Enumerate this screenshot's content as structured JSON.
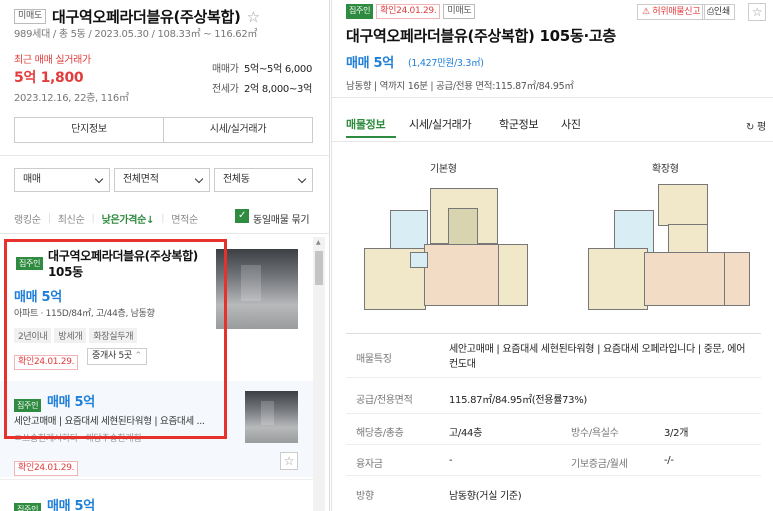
{
  "left": {
    "header": {
      "tag": "미매도",
      "title": "대구역오페라더블유(주상복합)",
      "star": "☆",
      "meta": "989세대 / 총 5동 / 2023.05.30 / 108.33㎡ ~ 116.62㎡"
    },
    "price_summary": {
      "label": "최근 매매 실거래가",
      "price": "5억 1,800",
      "date": "2023.12.16, 22층, 116㎡",
      "sale_label": "매매가",
      "sale_value": "5억~5억 6,000",
      "jeonse_label": "전세가",
      "jeonse_value": "2억 8,000~3억"
    },
    "buttons": {
      "info": "단지정보",
      "price": "시세/실거래가"
    },
    "filters": {
      "trade": "매매",
      "area": "전체면적",
      "dong": "전체동"
    },
    "sort": {
      "ranking": "랭킹순",
      "latest": "최신순",
      "low_price": "낮은가격순↓",
      "area": "면적순",
      "same_label": "동일매물 묶기"
    },
    "listing1": {
      "badge": "집주인",
      "title": "대구역오페라더블유(주상복합) 105동",
      "price": "매매 5억",
      "desc": "아파트 · 115D/84㎡, 고/44층, 남동향",
      "chips": [
        "2년이내",
        "방세개",
        "화장실두개"
      ],
      "confirm": "확인24.01.29.",
      "broker": "중개사 5곳"
    },
    "listing2": {
      "badge": "집주인",
      "price": "매매 5억",
      "desc": "세안고매매 | 요즘대세 세현된타워형 | 요즘대세 ...",
      "sub": "ㄹ쓰승한게시하다 · 해당주승한게힘",
      "confirm": "확인24.01.29.",
      "star": "☆"
    },
    "listing3": {
      "badge": "집주인",
      "price": "매매 5억"
    }
  },
  "right": {
    "tags": [
      "집주인",
      "확인24.01.29.",
      "미매도"
    ],
    "report": "허위매물신고",
    "print": "인쇄",
    "star": "☆",
    "title": "대구역오페라더블유(주상복합) 105동·고층",
    "price": "매매 5억",
    "price_sub": "(1,427만원/3.3㎡)",
    "facts": "남동향 | 역까지 16분 | 공급/전용 면적:115.87㎡/84.95㎡",
    "tabs": [
      "매물정보",
      "시세/실거래가",
      "학군정보",
      "사진"
    ],
    "refresh": "평",
    "floorplans": {
      "basic": "기본형",
      "extended": "확장형"
    },
    "details": [
      {
        "k": "매물특징",
        "v": "세안고매매 | 요즘대세 세현된타워형 | 요즘대세 오페라입니다 | 중문, 에어컨도대"
      },
      {
        "k": "공급/전용면적",
        "v": "115.87㎡/84.95㎡(전용률73%)"
      },
      {
        "k": "해당층/총층",
        "v": "고/44층",
        "k2": "방수/욕실수",
        "v2": "3/2개"
      },
      {
        "k": "융자금",
        "v": "-",
        "k2": "기보증금/월세",
        "v2": "-/-"
      },
      {
        "k": "방향",
        "v": "남동향(거실 기준)"
      }
    ]
  },
  "colors": {
    "accent_blue": "#1e7fd9",
    "green": "#2e8b3f",
    "red": "#e23c3c",
    "highlight": "#e5322d"
  }
}
